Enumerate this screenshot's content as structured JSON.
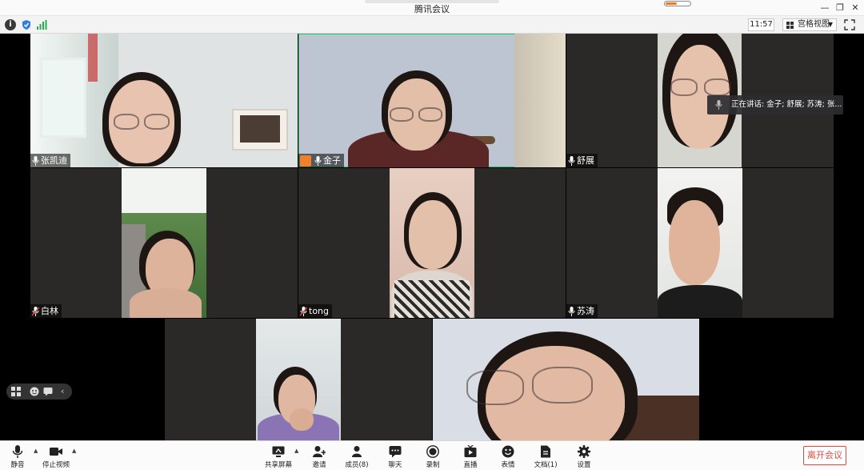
{
  "window": {
    "title": "腾讯会议"
  },
  "topbar": {
    "timer": "11:57",
    "view_mode": "宫格视图"
  },
  "participants": [
    {
      "name": "张凯迪",
      "mic": "on"
    },
    {
      "name": "金子",
      "mic": "on",
      "host": true,
      "speaking": true
    },
    {
      "name": "舒展",
      "mic": "on"
    },
    {
      "name": "白林",
      "mic": "muted"
    },
    {
      "name": "tong",
      "mic": "muted"
    },
    {
      "name": "苏涛",
      "mic": "on"
    },
    {
      "name": "",
      "mic": ""
    },
    {
      "name": "",
      "mic": ""
    }
  ],
  "speaking_tooltip": "正在讲话: 金子; 舒展; 苏涛; 张...",
  "toolbar": {
    "mute": "静音",
    "stop_video": "停止视频",
    "share_screen": "共享屏幕",
    "invite": "邀请",
    "members": "成员(8)",
    "chat": "聊天",
    "record": "录制",
    "live": "直播",
    "reactions": "表情",
    "docs": "文档(1)",
    "settings": "设置",
    "leave": "离开会议"
  },
  "colors": {
    "accent_green": "#1cc36a",
    "leave_red": "#e24a3f",
    "host_badge": "#f0812a",
    "tile_bg": "#2b2927"
  }
}
